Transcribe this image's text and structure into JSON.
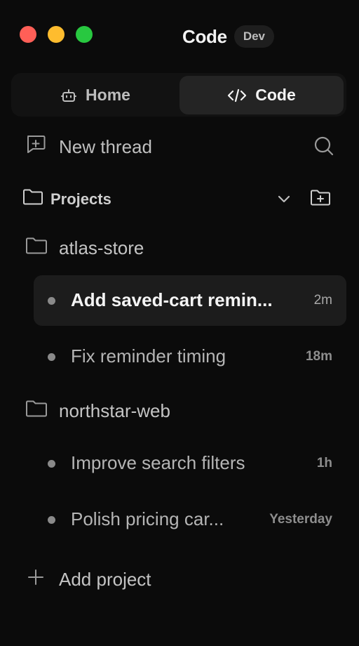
{
  "window": {
    "title": "Code",
    "badge": "Dev"
  },
  "tabs": [
    {
      "label": "Home",
      "icon": "robot-icon",
      "active": false
    },
    {
      "label": "Code",
      "icon": "code-icon",
      "active": true
    }
  ],
  "actions": {
    "new_thread_label": "New thread",
    "add_project_label": "Add project"
  },
  "projects_header": {
    "label": "Projects"
  },
  "projects": [
    {
      "name": "atlas-store",
      "threads": [
        {
          "title": "Add saved-cart remin...",
          "time": "2m",
          "active": true
        },
        {
          "title": "Fix reminder timing",
          "time": "18m",
          "active": false
        }
      ]
    },
    {
      "name": "northstar-web",
      "threads": [
        {
          "title": "Improve search filters",
          "time": "1h",
          "active": false
        },
        {
          "title": "Polish pricing car...",
          "time": "Yesterday",
          "active": false
        }
      ]
    }
  ],
  "colors": {
    "background": "#0b0b0b",
    "traffic_close": "#ff5f57",
    "traffic_minimize": "#febc2e",
    "traffic_zoom": "#28c840"
  }
}
